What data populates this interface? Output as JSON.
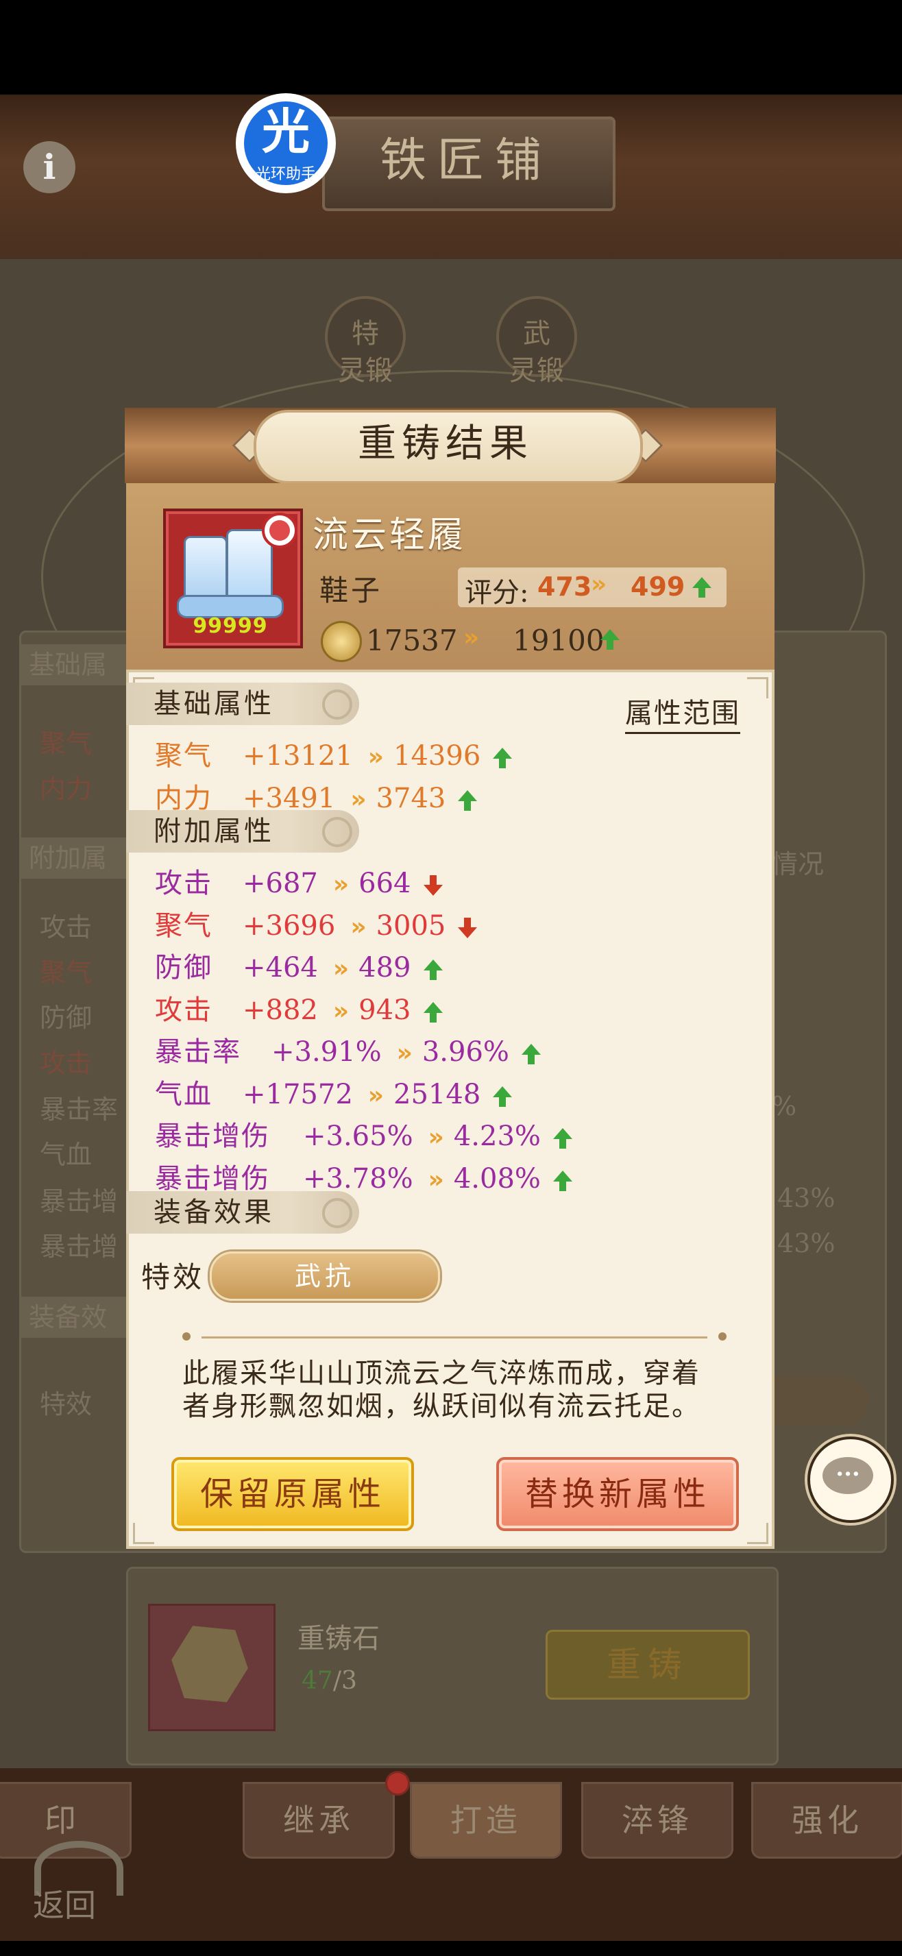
{
  "header": {
    "title": "铁匠铺",
    "info_icon": "i",
    "helper_badge": {
      "glyph": "光",
      "label": "光环助手"
    }
  },
  "forge_options": [
    {
      "glyph": "特",
      "label": "灵锻"
    },
    {
      "glyph": "武",
      "label": "灵锻"
    }
  ],
  "background_panel": {
    "section_basic": "基础属",
    "basic_rows": [
      "聚气",
      "内力"
    ],
    "section_extra": "附加属",
    "extra_rows": [
      "攻击",
      "聚气",
      "防御",
      "攻击",
      "暴击率",
      "气血",
      "暴击增",
      "暴击增"
    ],
    "right_fragments": [
      "情况",
      "%",
      "43%",
      "43%"
    ],
    "section_effect": "装备效",
    "effect_label": "特效",
    "material_name": "重铸石",
    "material_count_current": "47",
    "material_count_required": "/3",
    "reforge_button": "重铸"
  },
  "modal": {
    "title": "重铸结果",
    "item": {
      "name": "流云轻履",
      "type": "鞋子",
      "level_label": "99999",
      "score_label": "评分:",
      "score_old": "473",
      "score_new": "499",
      "power_old": "17537",
      "power_new": "19100"
    },
    "basic_section_label": "基础属性",
    "range_button": "属性范围",
    "basic_attrs": [
      {
        "name": "聚气",
        "old": "+13121",
        "new": "14396",
        "trend": "up",
        "color": "orange"
      },
      {
        "name": "内力",
        "old": "+3491",
        "new": "3743",
        "trend": "up",
        "color": "orange"
      }
    ],
    "extra_section_label": "附加属性",
    "extra_attrs": [
      {
        "name": "攻击",
        "old": "+687",
        "new": "664",
        "trend": "down",
        "color": "purple"
      },
      {
        "name": "聚气",
        "old": "+3696",
        "new": "3005",
        "trend": "down",
        "color": "red"
      },
      {
        "name": "防御",
        "old": "+464",
        "new": "489",
        "trend": "up",
        "color": "purple"
      },
      {
        "name": "攻击",
        "old": "+882",
        "new": "943",
        "trend": "up",
        "color": "red"
      },
      {
        "name": "暴击率",
        "old": "+3.91%",
        "new": "3.96%",
        "trend": "up",
        "color": "purple"
      },
      {
        "name": "气血",
        "old": "+17572",
        "new": "25148",
        "trend": "up",
        "color": "purple"
      },
      {
        "name": "暴击增伤",
        "old": "+3.65%",
        "new": "4.23%",
        "trend": "up",
        "color": "purple"
      },
      {
        "name": "暴击增伤",
        "old": "+3.78%",
        "new": "4.08%",
        "trend": "up",
        "color": "purple"
      }
    ],
    "effect_section_label": "装备效果",
    "effect_label": "特效",
    "effect_value": "武抗",
    "description_line1": "此履采华山山顶流云之气淬炼而成，穿着",
    "description_line2": "者身形飘忽如烟，纵跃间似有流云托足。",
    "keep_button": "保留原属性",
    "replace_button": "替换新属性"
  },
  "bottom_nav": {
    "tabs": [
      "印",
      "继承",
      "打造",
      "淬锋",
      "强化"
    ],
    "active_tab": "打造",
    "back_label": "返回"
  },
  "colors": {
    "attr_orange": "#e07a2a",
    "attr_purple": "#9a2aa0",
    "attr_red": "#e03a3a",
    "trend_up": "#3aa83a",
    "trend_down": "#d03a20",
    "helper_blue": "#1d6fe0"
  },
  "icons": [
    "info-icon",
    "helper-badge-icon",
    "boots-item-icon",
    "coin-icon",
    "up-arrow-icon",
    "down-arrow-icon",
    "chat-bubble-icon",
    "back-arrow-icon"
  ]
}
